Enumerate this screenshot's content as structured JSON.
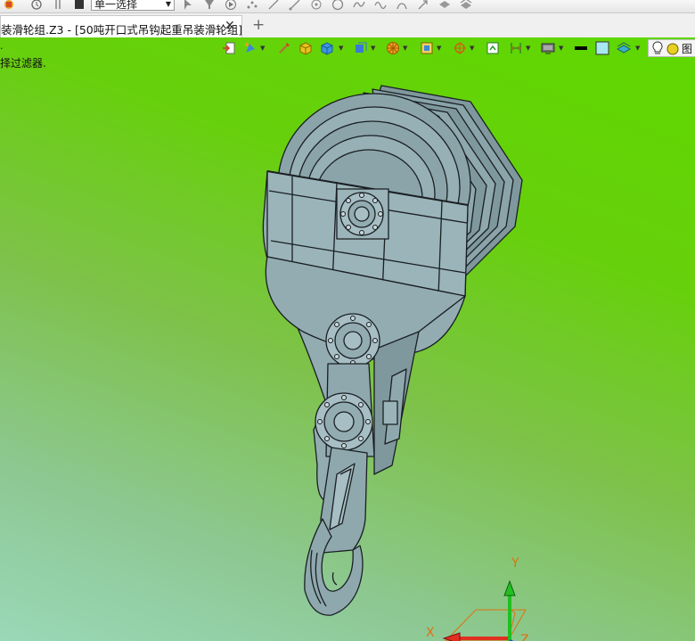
{
  "toolbar": {
    "selection_mode": "单一选择"
  },
  "document_tab": {
    "title": "装滑轮组.Z3 - [50吨开口式吊钩起重吊装滑轮组]",
    "close_glyph": "✕",
    "new_tab_glyph": "+"
  },
  "viewport": {
    "status_dot": ".",
    "status_message": "择过滤器.",
    "view_label": "图",
    "background_gradient": [
      "#5fd800",
      "#7ec24a",
      "#9ad8b8"
    ]
  },
  "triad": {
    "x_label": "X",
    "y_label": "Y",
    "z_label": "Z",
    "x_color": "#e03020",
    "y_color": "#20c020",
    "z_color": "#2040e0"
  },
  "model": {
    "name": "50吨开口式吊钩起重吊装滑轮组",
    "fill_color": "#8ea8ae",
    "edge_color": "#1a1f22"
  },
  "icons": {
    "toolbar": [
      "app-logo-icon",
      "history-icon",
      "pin-icon",
      "stop-icon",
      "pointer-icon",
      "filter-icon",
      "play-icon",
      "points-icon",
      "line-icon",
      "point-icon",
      "circle-icon",
      "spline-icon",
      "curve-icon",
      "stretch-icon",
      "arrow-icon",
      "layers-icon",
      "tools-icon"
    ],
    "view": [
      "import-icon",
      "sketch-icon",
      "brush-icon",
      "box-icon",
      "cube-icon",
      "render-icon",
      "sphere-icon",
      "frame-icon",
      "target-icon",
      "fit-icon",
      "measure-icon",
      "monitor-icon",
      "color-black-icon",
      "color-cyan-icon",
      "layer-icon",
      "light-icon"
    ]
  }
}
